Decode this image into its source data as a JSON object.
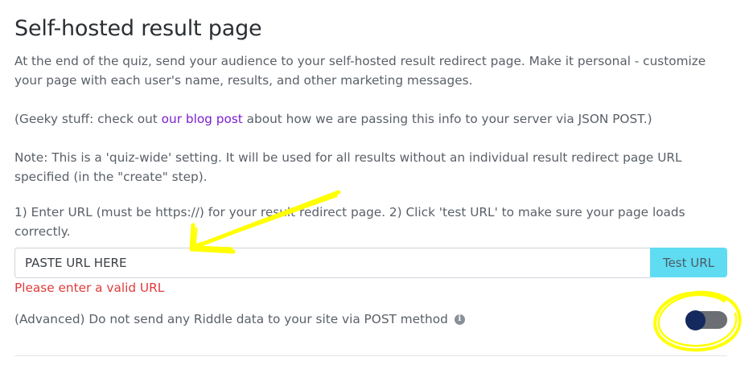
{
  "page": {
    "title": "Self-hosted result page",
    "description": "At the end of the quiz, send your audience to your self-hosted result redirect page. Make it personal - customize your page with each user's name, results, and other marketing messages.",
    "geeky_prefix": "(Geeky stuff: check out ",
    "geeky_link": "our blog post",
    "geeky_suffix": " about how we are passing this info to your server via JSON POST.)",
    "note": "Note: This is a 'quiz-wide' setting. It will be used for all results without an individual result redirect page URL specified (in the \"create\" step).",
    "instructions": "1) Enter URL (must be https://) for your result redirect page. 2) Click 'test URL' to make sure your page loads correctly."
  },
  "url_form": {
    "value": "PASTE URL HERE",
    "test_button_label": "Test URL",
    "error": "Please enter a valid URL"
  },
  "advanced": {
    "label": "(Advanced) Do not send any Riddle data to your site via POST method",
    "toggle_on": false
  },
  "colors": {
    "link": "#7b1fd1",
    "error": "#e03b3b",
    "button": "#5fdcf2",
    "toggle_knob": "#14295e",
    "toggle_track": "#6b6e72",
    "annotation": "#ffff00"
  },
  "icons": {
    "info": "info-icon"
  }
}
